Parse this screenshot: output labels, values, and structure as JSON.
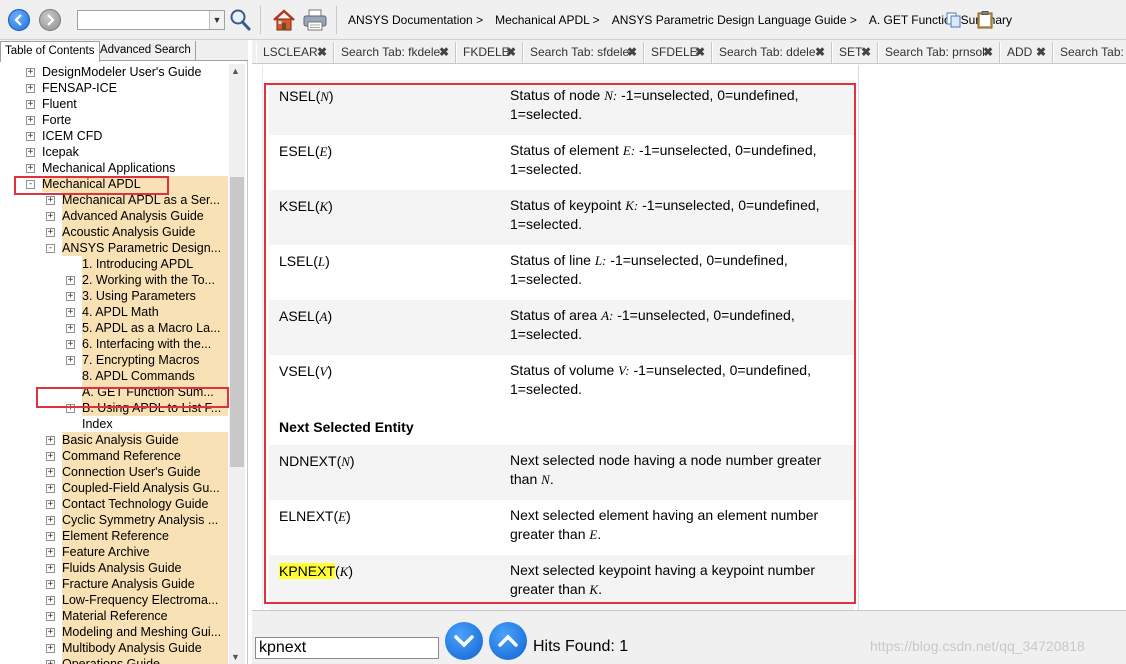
{
  "toolbar": {
    "back_icon": "back-arrow-icon",
    "forward_icon": "forward-arrow-icon",
    "search_value": "",
    "breadcrumbs": [
      "ANSYS Documentation >",
      "Mechanical APDL >",
      "ANSYS Parametric Design Language Guide >",
      "A. GET Function Summary"
    ]
  },
  "left_tabs": [
    "Table of Contents",
    "Advanced Search"
  ],
  "tree": [
    {
      "label": "DesignModeler User's Guide",
      "expander": "+",
      "level": 1,
      "highlight": false
    },
    {
      "label": "FENSAP-ICE",
      "expander": "+",
      "level": 1,
      "highlight": false
    },
    {
      "label": "Fluent",
      "expander": "+",
      "level": 1,
      "highlight": false
    },
    {
      "label": "Forte",
      "expander": "+",
      "level": 1,
      "highlight": false
    },
    {
      "label": "ICEM CFD",
      "expander": "+",
      "level": 1,
      "highlight": false
    },
    {
      "label": "Icepak",
      "expander": "+",
      "level": 1,
      "highlight": false
    },
    {
      "label": "Mechanical Applications",
      "expander": "+",
      "level": 1,
      "highlight": false
    },
    {
      "label": "Mechanical APDL",
      "expander": "-",
      "level": 1,
      "highlight": true
    },
    {
      "label": "Mechanical APDL as a Ser...",
      "expander": "+",
      "level": 2,
      "highlight": true
    },
    {
      "label": "Advanced Analysis Guide",
      "expander": "+",
      "level": 2,
      "highlight": true
    },
    {
      "label": "Acoustic Analysis Guide",
      "expander": "+",
      "level": 2,
      "highlight": true
    },
    {
      "label": "ANSYS Parametric Design...",
      "expander": "-",
      "level": 2,
      "highlight": true
    },
    {
      "label": "1. Introducing APDL",
      "expander": "",
      "level": 3,
      "highlight": true
    },
    {
      "label": "2. Working with the To...",
      "expander": "+",
      "level": 3,
      "highlight": true
    },
    {
      "label": "3. Using Parameters",
      "expander": "+",
      "level": 3,
      "highlight": true
    },
    {
      "label": "4. APDL Math",
      "expander": "+",
      "level": 3,
      "highlight": true
    },
    {
      "label": "5. APDL as a Macro La...",
      "expander": "+",
      "level": 3,
      "highlight": true
    },
    {
      "label": "6. Interfacing with the...",
      "expander": "+",
      "level": 3,
      "highlight": true
    },
    {
      "label": "7. Encrypting Macros",
      "expander": "+",
      "level": 3,
      "highlight": true
    },
    {
      "label": "8. APDL Commands",
      "expander": "",
      "level": 3,
      "highlight": true
    },
    {
      "label": "A. GET Function Sum...",
      "expander": "",
      "level": 3,
      "highlight": true
    },
    {
      "label": "B. Using APDL to List F...",
      "expander": "+",
      "level": 3,
      "highlight": true
    },
    {
      "label": "Index",
      "expander": "",
      "level": 3,
      "highlight": false
    },
    {
      "label": "Basic Analysis Guide",
      "expander": "+",
      "level": 2,
      "highlight": true
    },
    {
      "label": "Command Reference",
      "expander": "+",
      "level": 2,
      "highlight": true
    },
    {
      "label": "Connection User's Guide",
      "expander": "+",
      "level": 2,
      "highlight": true
    },
    {
      "label": "Coupled-Field Analysis Gu...",
      "expander": "+",
      "level": 2,
      "highlight": true
    },
    {
      "label": "Contact Technology Guide",
      "expander": "+",
      "level": 2,
      "highlight": true
    },
    {
      "label": "Cyclic Symmetry Analysis ...",
      "expander": "+",
      "level": 2,
      "highlight": true
    },
    {
      "label": "Element Reference",
      "expander": "+",
      "level": 2,
      "highlight": true
    },
    {
      "label": "Feature Archive",
      "expander": "+",
      "level": 2,
      "highlight": true
    },
    {
      "label": "Fluids Analysis Guide",
      "expander": "+",
      "level": 2,
      "highlight": true
    },
    {
      "label": "Fracture Analysis Guide",
      "expander": "+",
      "level": 2,
      "highlight": true
    },
    {
      "label": "Low-Frequency Electroma...",
      "expander": "+",
      "level": 2,
      "highlight": true
    },
    {
      "label": "Material Reference",
      "expander": "+",
      "level": 2,
      "highlight": true
    },
    {
      "label": "Modeling and Meshing Gui...",
      "expander": "+",
      "level": 2,
      "highlight": true
    },
    {
      "label": "Multibody Analysis Guide",
      "expander": "+",
      "level": 2,
      "highlight": true
    },
    {
      "label": "Operations Guide",
      "expander": "+",
      "level": 2,
      "highlight": true
    }
  ],
  "result_tabs": [
    "LSCLEAR",
    "Search Tab: fkdele",
    "FKDELE",
    "Search Tab: sfdele",
    "SFDELE",
    "Search Tab: ddele",
    "SET",
    "Search Tab: prnsol",
    "ADD",
    "Search Tab: kp"
  ],
  "tab_close": "✖",
  "content": {
    "rows": [
      {
        "fn": "NSEL",
        "arg": "N",
        "desc_pre": "Status of node ",
        "desc_arg": "N:",
        "desc_post": " -1=unselected, 0=undefined, 1=selected."
      },
      {
        "fn": "ESEL",
        "arg": "E",
        "desc_pre": "Status of element ",
        "desc_arg": "E:",
        "desc_post": " -1=unselected, 0=undefined, 1=selected."
      },
      {
        "fn": "KSEL",
        "arg": "K",
        "desc_pre": "Status of keypoint ",
        "desc_arg": "K:",
        "desc_post": " -1=unselected, 0=undefined, 1=selected."
      },
      {
        "fn": "LSEL",
        "arg": "L",
        "desc_pre": "Status of line ",
        "desc_arg": "L:",
        "desc_post": " -1=unselected, 0=undefined, 1=selected."
      },
      {
        "fn": "ASEL",
        "arg": "A",
        "desc_pre": "Status of area ",
        "desc_arg": "A:",
        "desc_post": " -1=unselected, 0=undefined, 1=selected."
      },
      {
        "fn": "VSEL",
        "arg": "V",
        "desc_pre": "Status of volume ",
        "desc_arg": "V:",
        "desc_post": " -1=unselected, 0=undefined, 1=selected."
      }
    ],
    "section_title": "Next Selected Entity",
    "next_rows": [
      {
        "fn": "NDNEXT",
        "arg": "N",
        "desc_pre": "Next selected node having a node number greater than ",
        "desc_arg": "N",
        "desc_post": "."
      },
      {
        "fn": "ELNEXT",
        "arg": "E",
        "desc_pre": "Next selected element having an element number greater than ",
        "desc_arg": "E",
        "desc_post": "."
      },
      {
        "fn": "KPNEXT",
        "arg": "K",
        "desc_pre": "Next selected keypoint having a keypoint number greater than ",
        "desc_arg": "K",
        "desc_post": "."
      }
    ]
  },
  "find_bar": {
    "query": "kpnext",
    "down_icon": "chevron-down-icon",
    "up_icon": "chevron-up-icon",
    "hits_text": "Hits Found: 1"
  },
  "watermark": "https://blog.csdn.net/qq_34720818",
  "colors": {
    "annotation_red": "#e0323c",
    "tree_highlight": "#f8e1b4",
    "search_highlight": "#ffff33",
    "accent_blue": "#0e62cc"
  }
}
